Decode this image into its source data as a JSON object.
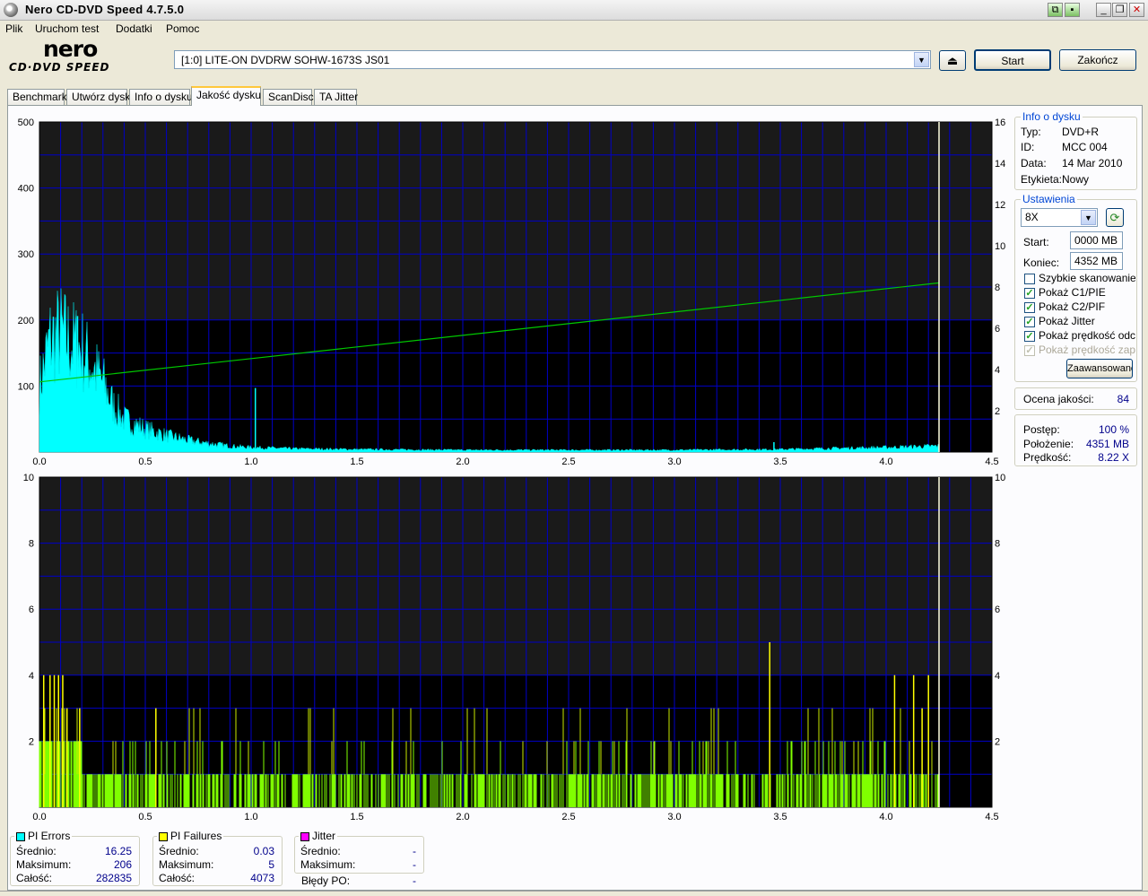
{
  "window": {
    "title": "Nero CD-DVD Speed 4.7.5.0"
  },
  "menu": [
    "Plik",
    "Uruchom test",
    "Dodatki",
    "Pomoc"
  ],
  "logo": {
    "top": "nero",
    "bottom": "CD·DVD SPEED"
  },
  "drive": {
    "selected": "[1:0]   LITE-ON DVDRW SOHW-1673S JS01"
  },
  "buttons": {
    "start": "Start",
    "stop": "Zakończ",
    "advanced": "Zaawansowane"
  },
  "tabs": [
    {
      "label": "Benchmark",
      "active": false
    },
    {
      "label": "Utwórz dysk",
      "active": false
    },
    {
      "label": "Info o dysku",
      "active": false
    },
    {
      "label": "Jakość dysku",
      "active": true
    },
    {
      "label": "ScanDisc",
      "active": false
    },
    {
      "label": "TA Jitter",
      "active": false
    }
  ],
  "disc_info": {
    "title": "Info o dysku",
    "rows": [
      {
        "label": "Typ:",
        "value": "DVD+R"
      },
      {
        "label": "ID:",
        "value": "MCC 004"
      },
      {
        "label": "Data:",
        "value": "14 Mar 2010"
      },
      {
        "label": "Etykieta:",
        "value": "Nowy"
      }
    ]
  },
  "settings": {
    "title": "Ustawienia",
    "speed": "8X",
    "start_label": "Start:",
    "start_value": "0000 MB",
    "end_label": "Koniec:",
    "end_value": "4352 MB",
    "options": [
      {
        "label": "Szybkie skanowanie",
        "checked": false,
        "disabled": false
      },
      {
        "label": "Pokaż C1/PIE",
        "checked": true,
        "disabled": false
      },
      {
        "label": "Pokaż C2/PIF",
        "checked": true,
        "disabled": false
      },
      {
        "label": "Pokaż Jitter",
        "checked": true,
        "disabled": false
      },
      {
        "label": "Pokaż prędkość odczytu",
        "checked": true,
        "disabled": false
      },
      {
        "label": "Pokaż prędkość zapisu",
        "checked": true,
        "disabled": true
      }
    ]
  },
  "quality": {
    "label": "Ocena jakości:",
    "value": "84"
  },
  "progress": {
    "rows": [
      {
        "label": "Postęp:",
        "value": "100 %"
      },
      {
        "label": "Położenie:",
        "value": "4351 MB"
      },
      {
        "label": "Prędkość:",
        "value": "8.22 X"
      }
    ]
  },
  "stats": {
    "pie": {
      "title": "PI Errors",
      "color": "#00ffff",
      "rows": [
        {
          "label": "Średnio:",
          "value": "16.25"
        },
        {
          "label": "Maksimum:",
          "value": "206"
        },
        {
          "label": "Całość:",
          "value": "282835"
        }
      ]
    },
    "pif": {
      "title": "PI Failures",
      "color": "#ffff00",
      "rows": [
        {
          "label": "Średnio:",
          "value": "0.03"
        },
        {
          "label": "Maksimum:",
          "value": "5"
        },
        {
          "label": "Całość:",
          "value": "4073"
        }
      ]
    },
    "jitter": {
      "title": "Jitter",
      "color": "#ff00ff",
      "rows": [
        {
          "label": "Średnio:",
          "value": "-"
        },
        {
          "label": "Maksimum:",
          "value": "-"
        },
        {
          "label": "Błędy PO:",
          "value": "-"
        }
      ]
    }
  },
  "chart_data": [
    {
      "type": "area",
      "series": [
        {
          "name": "PI Errors",
          "color": "#00ffff",
          "x": [
            0.0,
            0.05,
            0.1,
            0.15,
            0.2,
            0.25,
            0.3,
            0.35,
            0.4,
            0.5,
            0.6,
            0.7,
            0.8,
            0.9,
            1.0,
            1.1,
            1.2,
            1.5,
            2.0,
            2.5,
            3.0,
            3.5,
            4.0,
            4.25
          ],
          "y": [
            100,
            170,
            180,
            165,
            155,
            130,
            105,
            70,
            50,
            35,
            25,
            18,
            13,
            9,
            7,
            6,
            5,
            4,
            3,
            3,
            3,
            4,
            7,
            9
          ]
        },
        {
          "name": "Read speed",
          "color": "#00c800",
          "axis": "right",
          "x": [
            0.0,
            4.25
          ],
          "y": [
            3.4,
            8.2
          ]
        }
      ],
      "spikes": [
        {
          "x": 0.18,
          "y": 206
        },
        {
          "x": 1.02,
          "y": 97
        },
        {
          "x": 3.47,
          "y": 15
        }
      ],
      "end_marker_x": 4.25,
      "xlim": [
        0,
        4.5
      ],
      "ylim_left": [
        0,
        500
      ],
      "yticks_left": [
        100,
        200,
        300,
        400,
        500
      ],
      "ylim_right": [
        0,
        16
      ],
      "yticks_right": [
        2,
        4,
        6,
        8,
        10,
        12,
        14,
        16
      ],
      "xticks": [
        "0.0",
        "0.5",
        "1.0",
        "1.5",
        "2.0",
        "2.5",
        "3.0",
        "3.5",
        "4.0",
        "4.5"
      ]
    },
    {
      "type": "bar",
      "series": [
        {
          "name": "PI Failures",
          "color": "#80ff00"
        }
      ],
      "spikes_yellow": [
        {
          "x": 0.02,
          "y": 4
        },
        {
          "x": 0.05,
          "y": 4
        },
        {
          "x": 0.07,
          "y": 4
        },
        {
          "x": 0.09,
          "y": 4
        },
        {
          "x": 0.11,
          "y": 4
        },
        {
          "x": 0.13,
          "y": 3
        },
        {
          "x": 0.19,
          "y": 3
        },
        {
          "x": 0.55,
          "y": 3
        },
        {
          "x": 3.45,
          "y": 5
        },
        {
          "x": 4.04,
          "y": 4
        },
        {
          "x": 4.13,
          "y": 4
        },
        {
          "x": 4.17,
          "y": 3
        },
        {
          "x": 4.2,
          "y": 4
        }
      ],
      "end_marker_x": 4.25,
      "xlim": [
        0,
        4.5
      ],
      "ylim": [
        0,
        10
      ],
      "yticks": [
        2,
        4,
        6,
        8,
        10
      ],
      "xticks": [
        "0.0",
        "0.5",
        "1.0",
        "1.5",
        "2.0",
        "2.5",
        "3.0",
        "3.5",
        "4.0",
        "4.5"
      ]
    }
  ]
}
